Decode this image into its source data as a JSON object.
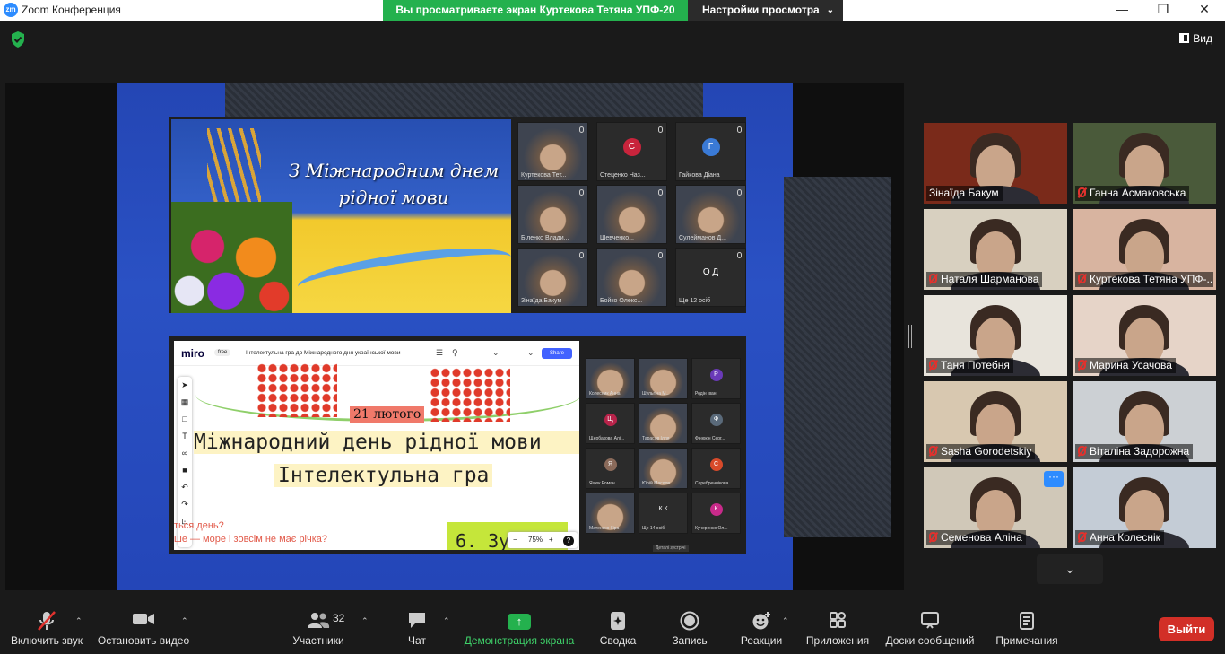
{
  "window": {
    "app_logo": "zm",
    "title": "Zoom Конференция",
    "share_banner": "Вы просматриваете экран Куртекова Тетяна УПФ-20",
    "view_settings": "Настройки просмотра",
    "view_button": "Вид"
  },
  "shared_screen": {
    "banner_text": "З Міжнародним днем рідної мови",
    "inner_tiles": [
      {
        "name": "Куртекова Тет..."
      },
      {
        "name": "Стеценко Наз...",
        "initial": "С",
        "color": "#c8243c"
      },
      {
        "name": "Гайкова Діана",
        "initial": "Г",
        "color": "#3a7ad6"
      },
      {
        "name": "Біленко Влади..."
      },
      {
        "name": "Шевченко..."
      },
      {
        "name": "Сулейманов Д..."
      },
      {
        "name": "Зінаїда Бакум"
      },
      {
        "name": "Бойко Олекс..."
      },
      {
        "name": "Ще 12 осіб",
        "initial": "О Д"
      }
    ],
    "miro": {
      "logo": "miro",
      "plan": "free",
      "board_title": "Інтелектульна гра до Міжнародного дня української мови",
      "share": "Share",
      "date": "21 лютого",
      "line1": "Міжнародний день рідної мови",
      "line2": "Інтелектульна гра",
      "q1": "ться день?",
      "q2": "ше — море і зовсім не має річка?",
      "green_card": "6. Зуп",
      "zoom_level": "75%",
      "zoom_minus": "−",
      "zoom_plus": "+",
      "help": "?"
    },
    "miro_tiles": [
      {
        "name": "Колесник Анна"
      },
      {
        "name": "Шульгіна М..."
      },
      {
        "name": "Родін Іван",
        "initial": "Р",
        "color": "#6a3ab8"
      },
      {
        "name": "Щербакова Алі...",
        "initial": "Щ",
        "color": "#b8234a"
      },
      {
        "name": "Тарасов Ілля"
      },
      {
        "name": "Фінюкін Серг...",
        "initial": "Ф",
        "color": "#5a6a7a"
      },
      {
        "name": "Яцюк Роман",
        "initial": "Я",
        "color": "#8a6a5a"
      },
      {
        "name": "Юрій Маслов"
      },
      {
        "name": "Серебреннікова...",
        "initial": "С",
        "color": "#d84a2a"
      },
      {
        "name": "Матенько Кіра"
      },
      {
        "name": "Ще 14 осіб",
        "initial": "К К"
      },
      {
        "name": "Кучеренко Ол...",
        "initial": "К",
        "color": "#c82a8a"
      }
    ],
    "details_label": "Деталі зустрічі"
  },
  "gallery": [
    {
      "name": "Зінаїда Бакум",
      "muted": false,
      "bg": "#7a2a1a"
    },
    {
      "name": "Ганна Асмаковська",
      "muted": true,
      "bg": "#4a5a3a"
    },
    {
      "name": "Наталя Шарманова",
      "muted": true,
      "bg": "#d8d0c0"
    },
    {
      "name": "Куртекова Тетяна УПФ-...",
      "muted": true,
      "bg": "#d8b4a0",
      "active": true
    },
    {
      "name": "Таня Потебня",
      "muted": true,
      "bg": "#e8e4dc"
    },
    {
      "name": "Марина Усачова",
      "muted": true,
      "bg": "#e6d4c8"
    },
    {
      "name": "Sasha Gorodetskiy",
      "muted": true,
      "bg": "#d8c8b0"
    },
    {
      "name": "Віталіна Задорожна",
      "muted": true,
      "bg": "#ccd0d4"
    },
    {
      "name": "Семенова Аліна",
      "muted": true,
      "bg": "#d0c8b8",
      "dots": "···"
    },
    {
      "name": "Анна Колеснік",
      "muted": true,
      "bg": "#c4ccd6"
    }
  ],
  "toolbar": {
    "mute": "Включить звук",
    "video": "Остановить видео",
    "participants": "Участники",
    "participants_count": "32",
    "chat": "Чат",
    "share": "Демонстрация экрана",
    "summary": "Сводка",
    "record": "Запись",
    "reactions": "Реакции",
    "apps": "Приложения",
    "whiteboards": "Доски сообщений",
    "notes": "Примечания",
    "leave": "Выйти"
  },
  "colors": {
    "share_green": "#24b14e",
    "leave_red": "#d22f27",
    "active_speaker": "#e6e67a",
    "slide_blue": "#2a51c4"
  }
}
